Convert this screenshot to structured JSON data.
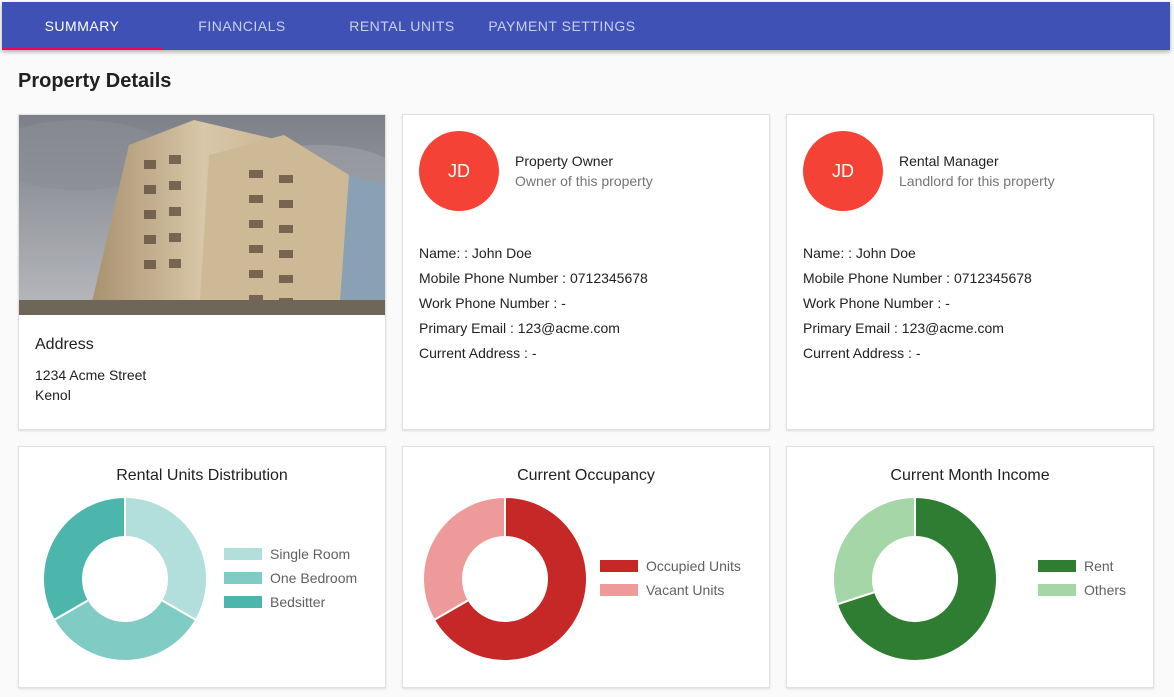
{
  "tabs": [
    {
      "label": "SUMMARY"
    },
    {
      "label": "FINANCIALS"
    },
    {
      "label": "RENTAL UNITS"
    },
    {
      "label": "PAYMENT SETTINGS"
    }
  ],
  "page_title": "Property Details",
  "address": {
    "title": "Address",
    "line1": "1234 Acme Street",
    "line2": "Kenol"
  },
  "owner": {
    "initials": "JD",
    "title": "Property Owner",
    "subtitle": "Owner of this property",
    "name": "Name: : John Doe",
    "mobile": "Mobile Phone Number : 0712345678",
    "work": "Work Phone Number : -",
    "email": "Primary Email : 123@acme.com",
    "address": "Current Address : -"
  },
  "manager": {
    "initials": "JD",
    "title": "Rental Manager",
    "subtitle": "Landlord for this property",
    "name": "Name: : John Doe",
    "mobile": "Mobile Phone Number : 0712345678",
    "work": "Work Phone Number : -",
    "email": "Primary Email : 123@acme.com",
    "address": "Current Address : -"
  },
  "colors": {
    "appbar": "#3f51b5",
    "tab_indicator": "#f50057",
    "avatar": "#f44336"
  },
  "chart_data": [
    {
      "type": "pie",
      "title": "Rental Units Distribution",
      "categories": [
        "Single Room",
        "One Bedroom",
        "Bedsitter"
      ],
      "values": [
        1,
        1,
        1
      ],
      "colors": [
        "#b2dfdb",
        "#80cbc4",
        "#4db6ac"
      ]
    },
    {
      "type": "pie",
      "title": "Current Occupancy",
      "categories": [
        "Occupied Units",
        "Vacant Units"
      ],
      "values": [
        2,
        1
      ],
      "colors": [
        "#c62828",
        "#ef9a9a"
      ]
    },
    {
      "type": "pie",
      "title": "Current Month Income",
      "categories": [
        "Rent",
        "Others"
      ],
      "values": [
        70,
        30
      ],
      "colors": [
        "#2e7d32",
        "#a5d6a7"
      ]
    }
  ]
}
